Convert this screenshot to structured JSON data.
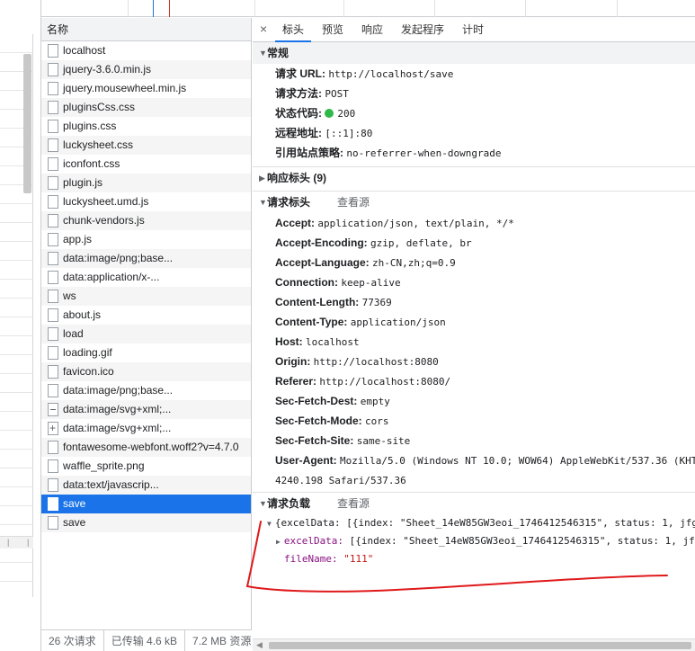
{
  "left_strip": {
    "scroll_marks": [
      "|",
      "|"
    ]
  },
  "request_list": {
    "header": "名称",
    "items": [
      {
        "name": "localhost",
        "icon": "doc-icon"
      },
      {
        "name": "jquery-3.6.0.min.js",
        "icon": "doc-icon"
      },
      {
        "name": "jquery.mousewheel.min.js",
        "icon": "doc-icon"
      },
      {
        "name": "pluginsCss.css",
        "icon": "doc-icon"
      },
      {
        "name": "plugins.css",
        "icon": "doc-icon"
      },
      {
        "name": "luckysheet.css",
        "icon": "doc-icon"
      },
      {
        "name": "iconfont.css",
        "icon": "doc-icon"
      },
      {
        "name": "plugin.js",
        "icon": "doc-icon"
      },
      {
        "name": "luckysheet.umd.js",
        "icon": "doc-icon"
      },
      {
        "name": "chunk-vendors.js",
        "icon": "doc-icon"
      },
      {
        "name": "app.js",
        "icon": "doc-icon"
      },
      {
        "name": "data:image/png;base...",
        "icon": "doc-icon"
      },
      {
        "name": "data:application/x-...",
        "icon": "doc-icon"
      },
      {
        "name": "ws",
        "icon": "doc-icon"
      },
      {
        "name": "about.js",
        "icon": "doc-icon"
      },
      {
        "name": "load",
        "icon": "doc-icon"
      },
      {
        "name": "loading.gif",
        "icon": "image-icon"
      },
      {
        "name": "favicon.ico",
        "icon": "doc-icon"
      },
      {
        "name": "data:image/png;base...",
        "icon": "doc-icon"
      },
      {
        "name": "data:image/svg+xml;...",
        "icon": "minus-icon"
      },
      {
        "name": "data:image/svg+xml;...",
        "icon": "plus-icon"
      },
      {
        "name": "fontawesome-webfont.woff2?v=4.7.0",
        "icon": "doc-icon"
      },
      {
        "name": "waffle_sprite.png",
        "icon": "doc-icon"
      },
      {
        "name": "data:text/javascrip...",
        "icon": "doc-icon"
      },
      {
        "name": "save",
        "icon": "doc-icon",
        "selected": true
      },
      {
        "name": "save",
        "icon": "doc-icon"
      }
    ],
    "footer": {
      "requests": "26 次请求",
      "transferred": "已传输 4.6 kB",
      "resources": "7.2 MB 资源"
    }
  },
  "detail": {
    "close": "×",
    "tabs": [
      "标头",
      "预览",
      "响应",
      "发起程序",
      "计时"
    ],
    "active_tab": "标头",
    "general": {
      "title": "常规",
      "rows": [
        {
          "k": "请求 URL:",
          "v": "http://localhost/save"
        },
        {
          "k": "请求方法:",
          "v": "POST"
        },
        {
          "k": "状态代码:",
          "v": "200"
        },
        {
          "k": "远程地址:",
          "v": "[::1]:80"
        },
        {
          "k": "引用站点策略:",
          "v": "no-referrer-when-downgrade"
        }
      ]
    },
    "response_headers": {
      "title": "响应标头 (9)"
    },
    "request_headers": {
      "title": "请求标头",
      "view_source": "查看源",
      "rows": [
        {
          "k": "Accept:",
          "v": "application/json, text/plain, */*"
        },
        {
          "k": "Accept-Encoding:",
          "v": "gzip, deflate, br"
        },
        {
          "k": "Accept-Language:",
          "v": "zh-CN,zh;q=0.9"
        },
        {
          "k": "Connection:",
          "v": "keep-alive"
        },
        {
          "k": "Content-Length:",
          "v": "77369"
        },
        {
          "k": "Content-Type:",
          "v": "application/json"
        },
        {
          "k": "Host:",
          "v": "localhost"
        },
        {
          "k": "Origin:",
          "v": "http://localhost:8080"
        },
        {
          "k": "Referer:",
          "v": "http://localhost:8080/"
        },
        {
          "k": "Sec-Fetch-Dest:",
          "v": "empty"
        },
        {
          "k": "Sec-Fetch-Mode:",
          "v": "cors"
        },
        {
          "k": "Sec-Fetch-Site:",
          "v": "same-site"
        },
        {
          "k": "User-Agent:",
          "v": "Mozilla/5.0 (Windows NT 10.0; WOW64) AppleWebKit/537.36 (KHT"
        }
      ],
      "ua_continuation": "4240.198 Safari/537.36"
    },
    "payload": {
      "title": "请求负载",
      "view_source": "查看源",
      "line1": "{excelData: [{index: \"Sheet_14eW85GW3eoi_1746412546315\", status: 1, jfg",
      "line2_key": "excelData:",
      "line2_val": " [{index: \"Sheet_14eW85GW3eoi_1746412546315\", status: 1, jf",
      "line3_key": "fileName:",
      "line3_val": " \"111\""
    }
  },
  "colors": {
    "selected": "#1a73e8",
    "status_ok": "#30b84a",
    "annotation": "#e0191b"
  }
}
